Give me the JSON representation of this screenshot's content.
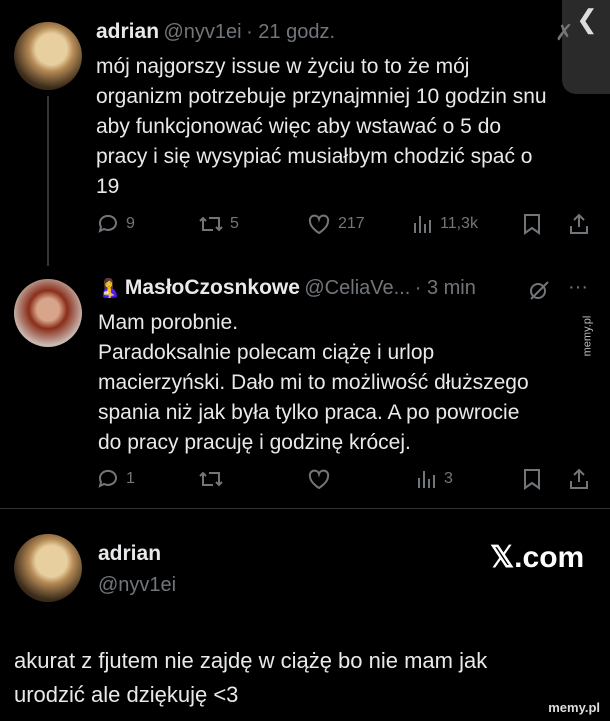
{
  "tweet1": {
    "name": "adrian",
    "handle": "@nyv1ei",
    "time": "· 21 godz.",
    "lines": [
      "mój najgorszy issue w życiu to to że mój",
      "organizm potrzebuje przynajmniej 10 godzin snu",
      "aby funkcjonować więc aby wstawać o 5 do",
      "pracy i się wysypiać musiałbym chodzić spać o",
      "19"
    ],
    "replies": "9",
    "retweets": "5",
    "likes": "217",
    "views": "11,3k"
  },
  "tweet2": {
    "emoji": "🤱",
    "name": "MasłoCzosnkowe",
    "handle": "@CeliaVe...",
    "time": "· 3 min",
    "more": "···",
    "lines": [
      "Mam porobnie.",
      "Paradoksalnie polecam ciążę i urlop",
      "macierzyński. Dało mi to możliwość dłuższego",
      "spania niż jak była tylko praca. A po powrocie",
      "do pracy pracuję i godzinę krócej."
    ],
    "replies": "1",
    "views": "3"
  },
  "tweet3": {
    "name": "adrian",
    "handle": "@nyv1ei",
    "lines": [
      "akurat z fjutem nie zajdę w ciążę bo nie mam jak",
      "urodzić ale dziękuję <3"
    ]
  },
  "brand": "𝕏.com",
  "watermark": "memy.pl",
  "watermark_side": "memy.pl",
  "back_glyph": "❮",
  "close_glyph": "✗"
}
